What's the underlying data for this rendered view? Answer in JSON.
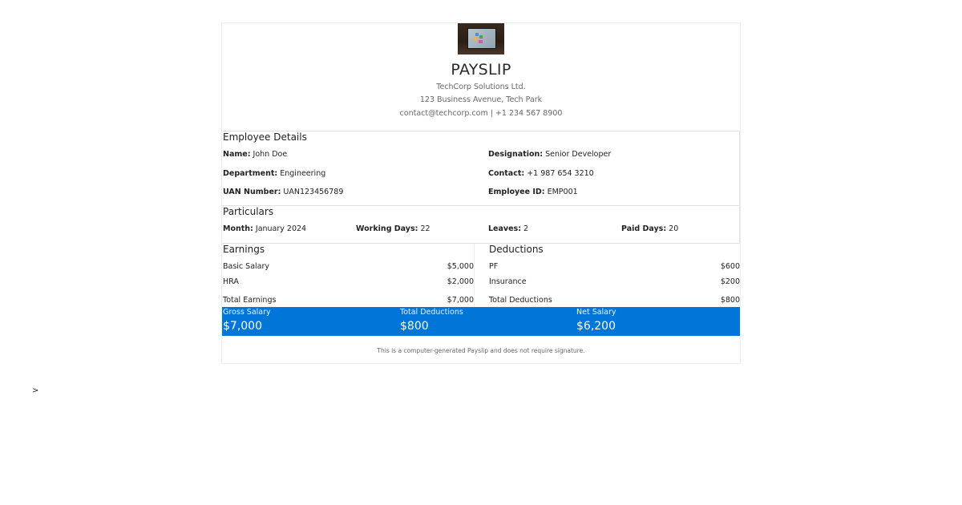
{
  "header": {
    "title": "PAYSLIP",
    "company": "TechCorp Solutions Ltd.",
    "address": "123 Business Avenue, Tech Park",
    "contact_line": "contact@techcorp.com | +1 234 567 8900"
  },
  "employee": {
    "section_title": "Employee Details",
    "name_label": "Name:",
    "name": "John Doe",
    "designation_label": "Designation:",
    "designation": "Senior Developer",
    "department_label": "Department:",
    "department": "Engineering",
    "contact_label": "Contact:",
    "contact": "+1 987 654 3210",
    "uan_label": "UAN Number:",
    "uan": "UAN123456789",
    "id_label": "Employee ID:",
    "id": "EMP001"
  },
  "particulars": {
    "section_title": "Particulars",
    "month_label": "Month:",
    "month": "January 2024",
    "working_days_label": "Working Days:",
    "working_days": "22",
    "leaves_label": "Leaves:",
    "leaves": "2",
    "paid_days_label": "Paid Days:",
    "paid_days": "20"
  },
  "earnings": {
    "section_title": "Earnings",
    "rows": [
      {
        "label": "Basic Salary",
        "value": "$5,000"
      },
      {
        "label": "HRA",
        "value": "$2,000"
      }
    ],
    "total_label": "Total Earnings",
    "total_value": "$7,000"
  },
  "deductions": {
    "section_title": "Deductions",
    "rows": [
      {
        "label": "PF",
        "value": "$600"
      },
      {
        "label": "Insurance",
        "value": "$200"
      }
    ],
    "total_label": "Total Deductions",
    "total_value": "$800"
  },
  "summary": {
    "gross_label": "Gross Salary",
    "gross_value": "$7,000",
    "deductions_label": "Total Deductions",
    "deductions_value": "$800",
    "net_label": "Net Salary",
    "net_value": "$6,200",
    "color": "#0275d8"
  },
  "footer": {
    "note": "This is a computer-generated Payslip and does not require signature."
  },
  "stray_text": ">"
}
